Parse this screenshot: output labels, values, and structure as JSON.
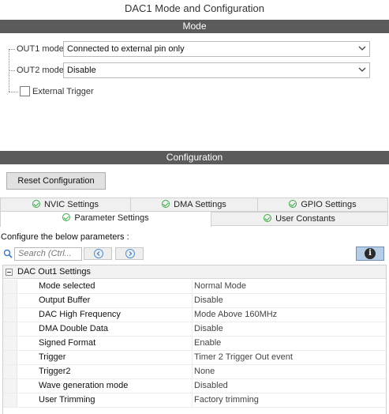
{
  "window": {
    "title": "DAC1 Mode and Configuration"
  },
  "mode_section": {
    "header": "Mode",
    "out1": {
      "label": "OUT1 mode",
      "value": "Connected to external pin only"
    },
    "out2": {
      "label": "OUT2 mode",
      "value": "Disable"
    },
    "external_trigger": {
      "label": "External Trigger",
      "checked": false
    }
  },
  "config_section": {
    "header": "Configuration",
    "reset_button": "Reset Configuration",
    "tabs_row1": [
      {
        "label": "NVIC Settings",
        "icon": "check-circle-icon"
      },
      {
        "label": "DMA Settings",
        "icon": "check-circle-icon"
      },
      {
        "label": "GPIO Settings",
        "icon": "check-circle-icon"
      }
    ],
    "tabs_row2": [
      {
        "label": "Parameter Settings",
        "icon": "check-circle-icon",
        "active": true
      },
      {
        "label": "User Constants",
        "icon": "check-circle-icon",
        "active": false
      }
    ],
    "configure_label": "Configure the below parameters :",
    "search_placeholder": "Search (Ctrl...",
    "group": "DAC Out1 Settings",
    "parameters": [
      {
        "name": "Mode selected",
        "value": "Normal Mode"
      },
      {
        "name": "Output Buffer",
        "value": "Disable"
      },
      {
        "name": "DAC High Frequency",
        "value": "Mode Above 160MHz"
      },
      {
        "name": "DMA Double Data",
        "value": "Disable"
      },
      {
        "name": "Signed Format",
        "value": "Enable"
      },
      {
        "name": "Trigger",
        "value": "Timer 2 Trigger Out event"
      },
      {
        "name": "Trigger2",
        "value": "None"
      },
      {
        "name": "Wave generation mode",
        "value": "Disabled"
      },
      {
        "name": "User Trimming",
        "value": "Factory trimming"
      }
    ]
  },
  "colors": {
    "section_bar": "#5b5b5b",
    "ok_green": "#3aa845",
    "info_blue": "#b7cde6"
  }
}
